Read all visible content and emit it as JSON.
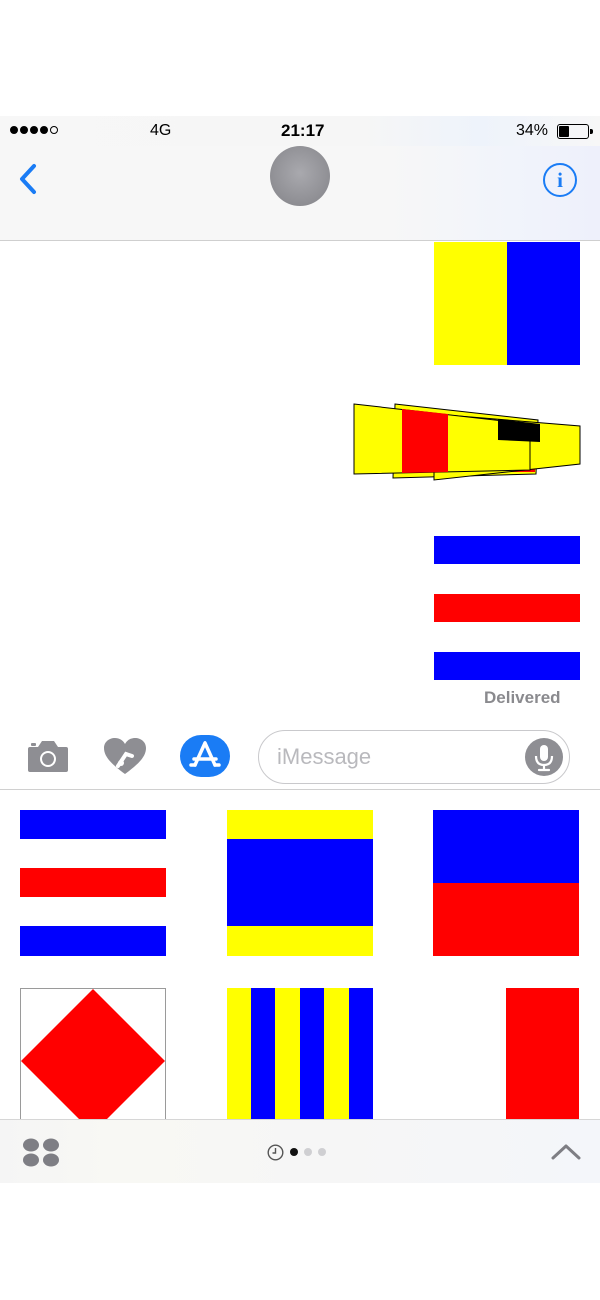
{
  "status_bar": {
    "signal_bars": 5,
    "signal_filled": 4,
    "network": "4G",
    "time": "21:17",
    "battery_text": "34%",
    "battery_level": 0.34
  },
  "nav": {
    "back_icon": "chevron-left-icon",
    "avatar": "contact-avatar",
    "info_icon": "info-icon",
    "info_glyph": "i",
    "accent_color": "#1a7cf5"
  },
  "conversation": {
    "messages": [
      {
        "kind": "sticker",
        "flag": "yellow-blue-vertical-halves"
      },
      {
        "kind": "sticker",
        "flag": "overlapping-yellow-red-striped-pennants"
      },
      {
        "kind": "sticker",
        "flag": "blue-white-red-horizontal-stripes"
      }
    ],
    "delivered": "Delivered"
  },
  "compose": {
    "camera_icon": "camera-icon",
    "digital_touch_icon": "heart-touch-icon",
    "app_store_icon": "app-store-icon",
    "placeholder": "iMessage",
    "mic_icon": "microphone-icon"
  },
  "sticker_drawer": {
    "stickers": [
      "blue-white-red-horizontal-stripes",
      "yellow-blue-yellow-horizontal-bands",
      "blue-over-red-halves",
      "red-diamond-on-white",
      "yellow-blue-vertical-stripes",
      "red-vertical-half"
    ]
  },
  "bottom_bar": {
    "apps_icon": "app-drawer-icon",
    "recent_icon": "clock-icon",
    "pages": 3,
    "active_page": 1,
    "expand_icon": "chevron-up-icon"
  },
  "colors": {
    "flag_yellow": "#ffff00",
    "flag_blue": "#0000ff",
    "flag_red": "#ff0000",
    "flag_black": "#000000"
  }
}
